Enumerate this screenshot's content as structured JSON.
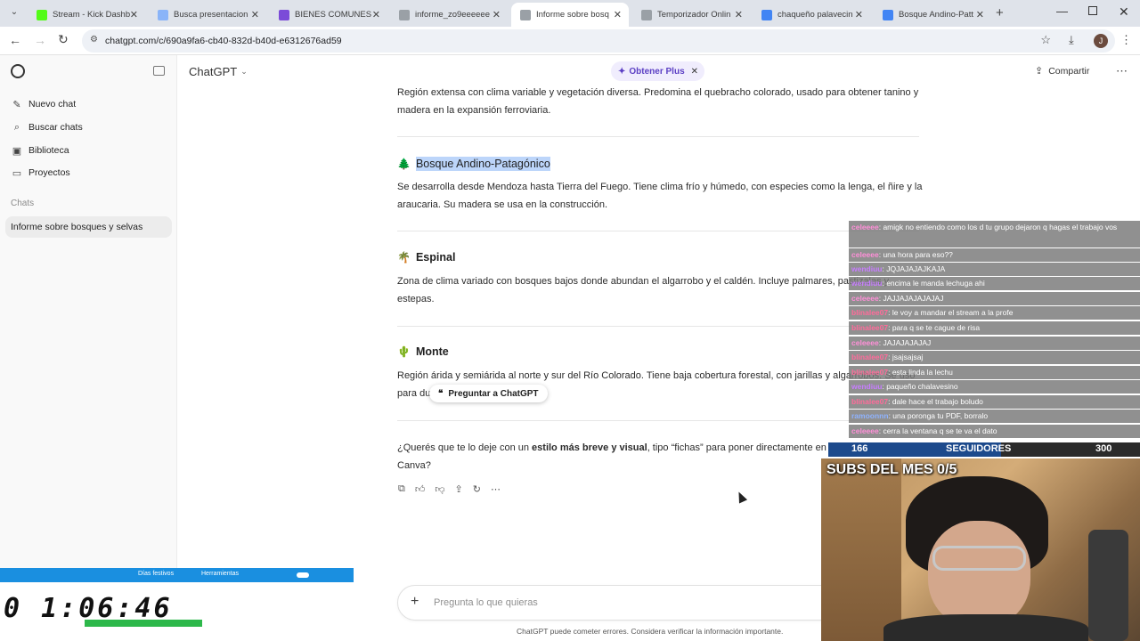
{
  "browser": {
    "tabs": [
      {
        "label": "Stream - Kick Dashb",
        "color": "#53fc18"
      },
      {
        "label": "Busca presentacion",
        "color": "#8ab4f8"
      },
      {
        "label": "BIENES COMUNES",
        "color": "#7b4bd8"
      },
      {
        "label": "informe_zo9eeeeee",
        "color": "#9aa0a6"
      },
      {
        "label": "Informe sobre bosq",
        "color": "#9aa0a6"
      },
      {
        "label": "Temporizador Onlin",
        "color": "#9aa0a6"
      },
      {
        "label": "chaqueño palavecin",
        "color": "#4285f4"
      },
      {
        "label": "Bosque Andino-Patt",
        "color": "#4285f4"
      }
    ],
    "new_tab": "+",
    "url": "chatgpt.com/c/690a9fa6-cb40-832d-b40d-e6312676ad59",
    "profile_initial": "J"
  },
  "sidebar": {
    "items": [
      {
        "label": "Nuevo chat",
        "icon": "edit-icon"
      },
      {
        "label": "Buscar chats",
        "icon": "search-icon"
      },
      {
        "label": "Biblioteca",
        "icon": "library-icon"
      },
      {
        "label": "Proyectos",
        "icon": "folder-icon"
      }
    ],
    "section_label": "Chats",
    "chat_items": [
      "Informe sobre bosques y selvas"
    ]
  },
  "header": {
    "model_label": "ChatGPT",
    "upgrade_label": "Obtener Plus",
    "share_label": "Compartir"
  },
  "content": {
    "intro_para": "Región extensa con clima variable y vegetación diversa. Predomina el quebracho colorado, usado para obtener tanino y madera en la expansión ferroviaria.",
    "sections": [
      {
        "emoji": "🌲",
        "title": "Bosque Andino-Patagónico",
        "text": "Se desarrolla desde Mendoza hasta Tierra del Fuego. Tiene clima frío y húmedo, con especies como la lenga, el ñire y la araucaria. Su madera se usa en la construcción."
      },
      {
        "emoji": "🌴",
        "title": "Espinal",
        "text": "Zona de clima variado con bosques bajos donde abundan el algarrobo y el caldén. Incluye palmares, pastizales y estepas."
      },
      {
        "emoji": "🌵",
        "title": "Monte",
        "text": "Región árida y semiárida al norte y sur del Río Colorado. Tiene baja cobertura forestal, con jarillas y algarrobos. Se usó para durmientes de tren."
      }
    ],
    "question_prefix": "¿Querés que te lo deje con un ",
    "question_bold": "estilo más breve y visual",
    "question_suffix": ", tipo “fichas” para poner directamente en tu presentación de Canva?",
    "ask_tooltip": "Preguntar a ChatGPT",
    "composer_placeholder": "Pregunta lo que quieras",
    "footer_note": "ChatGPT puede cometer errores. Considera verificar la información importante."
  },
  "stream_overlay": {
    "chat": [
      {
        "user": "celeeee",
        "text": ": amigk no entiendo como los d tu grupo dejaron q hagas el trabajo vos",
        "color": "#ff8fd8"
      },
      {
        "user": "celeeee",
        "text": ": una hora para eso??",
        "color": "#ff8fd8"
      },
      {
        "user": "wendiuu",
        "text": ": JQJAJAJAJKAJA",
        "color": "#c77dff"
      },
      {
        "user": "wendiuu",
        "text": ": encima le manda lechuga ahi",
        "color": "#c77dff"
      },
      {
        "user": "celeeee",
        "text": ": JAJJAJAJAJAJAJ",
        "color": "#ff8fd8"
      },
      {
        "user": "blinalee07",
        "text": ": le voy a mandar el stream a la profe",
        "color": "#ff6b9a"
      },
      {
        "user": "blinalee07",
        "text": ": para q se te cague de risa",
        "color": "#ff6b9a"
      },
      {
        "user": "celeeee",
        "text": ": JAJAJAJAJAJ",
        "color": "#ff8fd8"
      },
      {
        "user": "blinalee07",
        "text": ": jsajsajsaj",
        "color": "#ff6b9a"
      },
      {
        "user": "blinalee07",
        "text": ": esta linda la lechu",
        "color": "#ff6b9a"
      },
      {
        "user": "wendiuu",
        "text": ": paqueño chalavesino",
        "color": "#c77dff"
      },
      {
        "user": "blinalee07",
        "text": ": dale hace el trabajo boludo",
        "color": "#ff6b9a"
      },
      {
        "user": "ramoonnn",
        "text": ": una poronga tu PDF, borralo",
        "color": "#8fb3ff"
      },
      {
        "user": "celeeee",
        "text": ": cerra la ventana q se te va el dato",
        "color": "#ff8fd8"
      }
    ],
    "followers_current": "166",
    "followers_label": "SEGUIDORES",
    "followers_goal": "300",
    "subs_label": "SUBS DEL MES 0/5",
    "timer": "0 1:06:46",
    "timer_tabs": [
      "Días festivos",
      "Herramientas"
    ]
  }
}
